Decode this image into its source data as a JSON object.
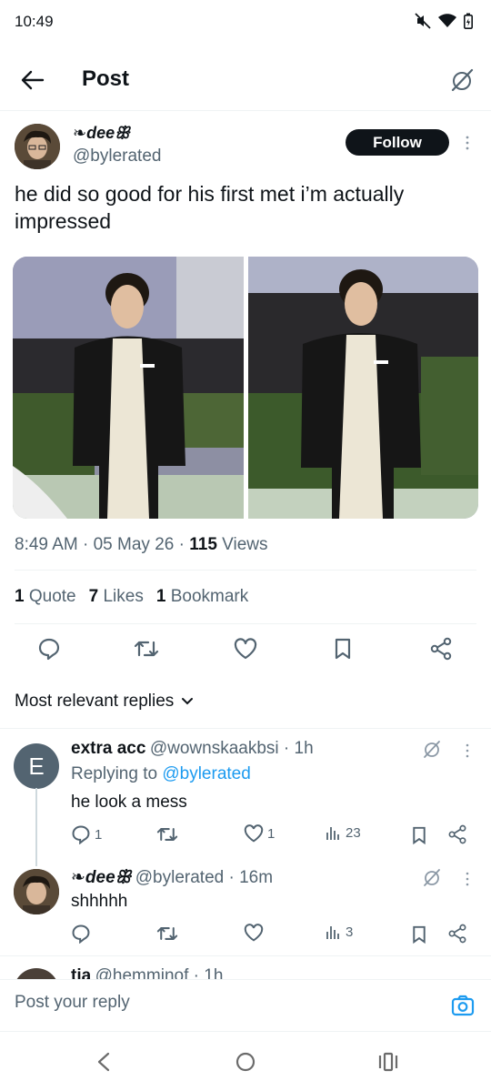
{
  "status_bar": {
    "time": "10:49"
  },
  "header": {
    "title": "Post"
  },
  "post": {
    "author_name": "❧deeꕥ",
    "author_handle": "@bylerated",
    "follow_label": "Follow",
    "text": "he did so good for his first met i’m actually impressed",
    "time": "8:49 AM",
    "date": "05 May 26",
    "views_count": "115",
    "views_label": "Views",
    "quotes_count": "1",
    "quotes_label": "Quote",
    "likes_count": "7",
    "likes_label": "Likes",
    "bookmarks_count": "1",
    "bookmarks_label": "Bookmark"
  },
  "sort": {
    "label": "Most relevant replies"
  },
  "replies": [
    {
      "avatar_letter": "E",
      "name": "extra acc",
      "handle": "@wownskaakbsi",
      "time": "1h",
      "replying_prefix": "Replying to",
      "replying_to": "@bylerated",
      "text": "he look a mess",
      "reply_count": "1",
      "retweet_count": "",
      "like_count": "1",
      "view_count": "23"
    },
    {
      "name": "❧deeꕥ",
      "handle": "@bylerated",
      "time": "16m",
      "text": "shhhhh",
      "reply_count": "",
      "retweet_count": "",
      "like_count": "",
      "view_count": "3"
    },
    {
      "name": "tia",
      "handle": "@hemminof",
      "time": "1h"
    }
  ],
  "composer": {
    "placeholder": "Post your reply"
  },
  "colors": {
    "accent": "#1d9bf0",
    "text": "#0f1419",
    "muted": "#536471",
    "divider": "#eff3f4"
  },
  "icons": [
    "back-arrow-icon",
    "grok-icon",
    "more-icon",
    "reply-icon",
    "retweet-icon",
    "like-icon",
    "bookmark-icon",
    "share-icon",
    "views-icon",
    "chevron-down-icon",
    "camera-icon"
  ]
}
